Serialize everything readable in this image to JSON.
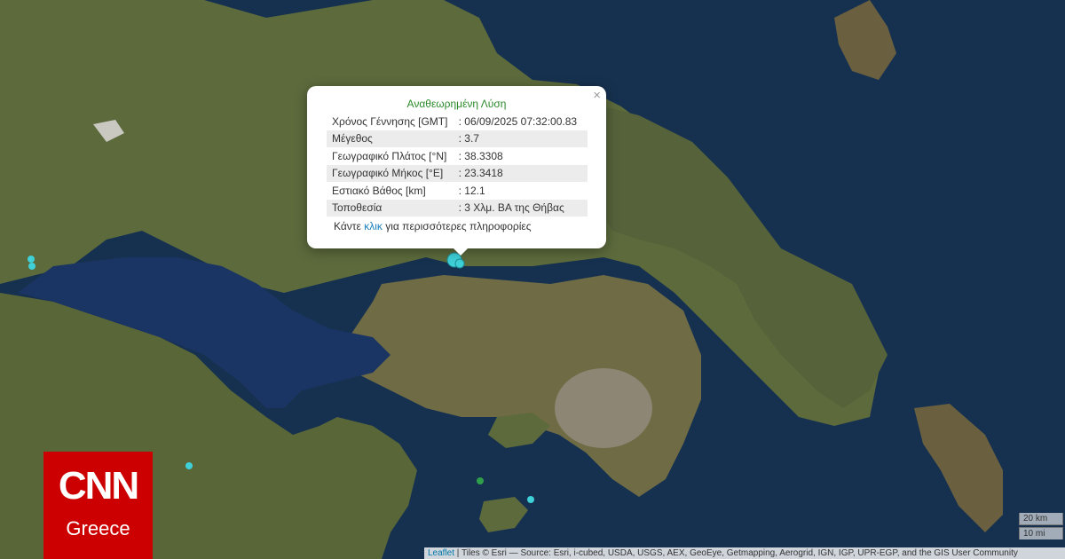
{
  "popup": {
    "close": "×",
    "title": "Αναθεωρημένη Λύση",
    "rows": [
      {
        "label": "Χρόνος Γέννησης [GMT]",
        "value": ": 06/09/2025 07:32:00.83"
      },
      {
        "label": "Μέγεθος",
        "value": ": 3.7"
      },
      {
        "label": "Γεωγραφικό Πλάτος [°N]",
        "value": ": 38.3308"
      },
      {
        "label": "Γεωγραφικό Μήκος [°E]",
        "value": ": 23.3418"
      },
      {
        "label": "Εστιακό Βάθος [km]",
        "value": ": 12.1"
      },
      {
        "label": "Τοποθεσία",
        "value": ": 3 Χλμ. ΒΑ της Θήβας"
      }
    ],
    "footer_pre": "Κάντε ",
    "footer_link": "κλικ",
    "footer_post": " για περισσότερες πληροφορίες"
  },
  "logo": {
    "line1": "CNN",
    "line2": "Greece"
  },
  "scale": {
    "metric": "20 km",
    "imperial": "10 mi"
  },
  "attribution": {
    "leaflet": "Leaflet",
    "text": " | Tiles © Esri — Source: Esri, i-cubed, USDA, USGS, AEX, GeoEye, Getmapping, Aerogrid, IGN, IGP, UPR-EGP, and the GIS User Community"
  },
  "colors": {
    "marker_cyan": "#3fd0d8",
    "marker_green": "#2e9e4a",
    "popup_title": "#2b8a2b",
    "logo_red": "#cc0000"
  }
}
